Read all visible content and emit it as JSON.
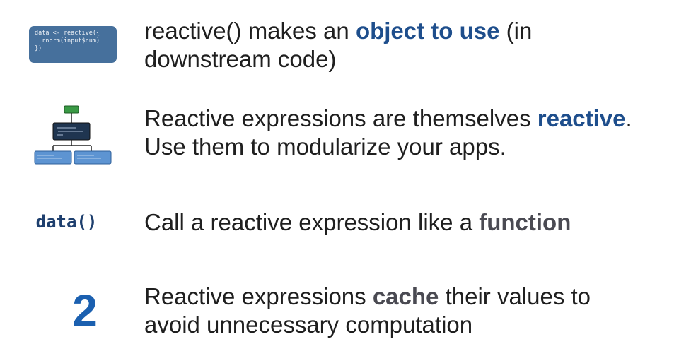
{
  "row1": {
    "code_lines": [
      "data <- reactive({",
      "  rnorm(input$num)",
      "})"
    ],
    "line1_pre": "reactive() makes an ",
    "line1_hl": "object to use",
    "line1_post": " (in",
    "line2": "downstream code)"
  },
  "row2": {
    "line1_pre": "Reactive expressions are themselves ",
    "line1_hl": "reactive",
    "line1_post": ".",
    "line2": "Use them to modularize your apps."
  },
  "row3": {
    "code_call": "data()",
    "line1_pre": "Call a reactive expression like a ",
    "line1_hl": "function"
  },
  "row4": {
    "number": "2",
    "line1_pre": "Reactive expressions ",
    "line1_hl": "cache",
    "line1_post": " their values to",
    "line2": "avoid unnecessary computation"
  },
  "colors": {
    "highlight_blue": "#1e4e8c",
    "highlight_gray": "#4a4a52",
    "code_box": "#46709c",
    "number": "#1b60b0",
    "diagram_top": "#3a9a45",
    "diagram_middle": "#1f3550",
    "diagram_leaves": "#5d94d2"
  }
}
